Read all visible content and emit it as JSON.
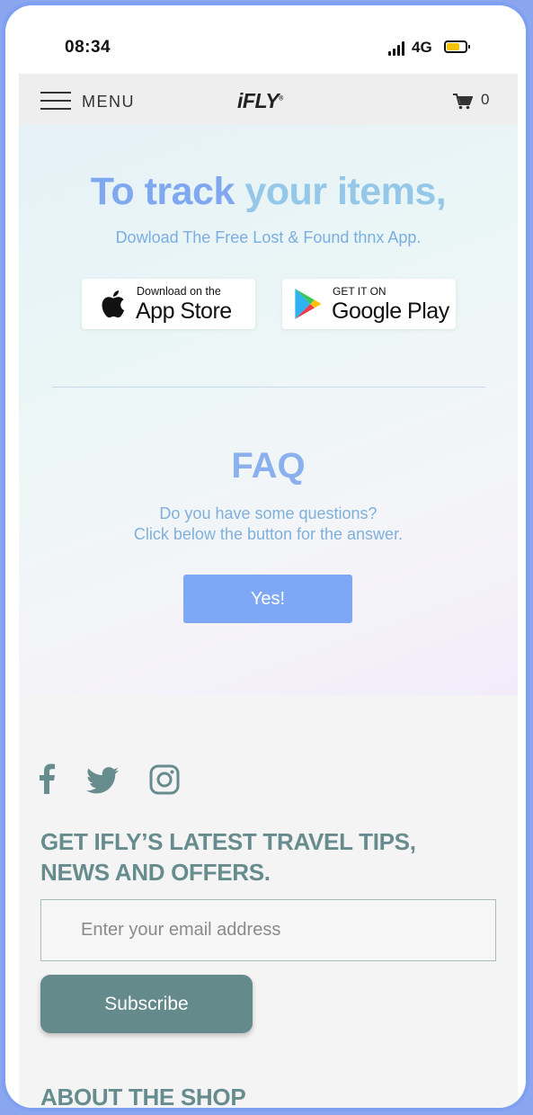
{
  "status_bar": {
    "time": "08:34",
    "network": "4G"
  },
  "navbar": {
    "menu_label": "MENU",
    "logo_text": "iFLY",
    "logo_mark": "®",
    "cart_count": "0"
  },
  "hero": {
    "title_part1": "To track ",
    "title_part2": "your items,",
    "subtitle": "Dowload The Free Lost & Found thnx App.",
    "app_store": {
      "small": "Download on the",
      "big": "App Store"
    },
    "google_play": {
      "small": "GET IT ON",
      "big": "Google Play"
    }
  },
  "faq": {
    "title": "FAQ",
    "line1": "Do you have some questions?",
    "line2": "Click below the button for the answer.",
    "button_label": "Yes!"
  },
  "footer": {
    "newsletter_line1": "GET IFLY’S LATEST TRAVEL TIPS,",
    "newsletter_line2": "NEWS AND OFFERS.",
    "email_placeholder": "Enter your email address",
    "subscribe_label": "Subscribe",
    "about_title": "ABOUT THE SHOP"
  },
  "colors": {
    "accent_blue": "#7ea8f5",
    "teal": "#658a8b",
    "battery": "#f4c400"
  },
  "icons": [
    "apple-icon",
    "google-play-icon",
    "cart-icon",
    "facebook-icon",
    "twitter-icon",
    "instagram-icon",
    "hamburger-icon"
  ]
}
